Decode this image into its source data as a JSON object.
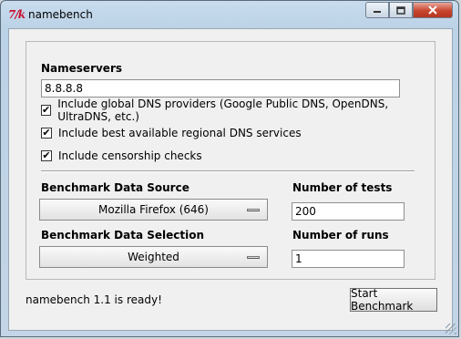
{
  "window": {
    "title": "namebench",
    "icon_label": "7/k",
    "icon": "tk-feather-icon",
    "controls": {
      "minimize": "minimize-icon",
      "maximize": "maximize-icon",
      "close": "close-icon"
    }
  },
  "nameservers": {
    "label": "Nameservers",
    "value": "8.8.8.8"
  },
  "options": [
    {
      "label": "Include global DNS providers (Google Public DNS, OpenDNS, UltraDNS, etc.)",
      "checked": true
    },
    {
      "label": "Include best available regional DNS services",
      "checked": true
    },
    {
      "label": "Include censorship checks",
      "checked": true
    }
  ],
  "benchmark_source": {
    "label": "Benchmark Data Source",
    "selected": "Mozilla Firefox (646)"
  },
  "benchmark_selection": {
    "label": "Benchmark Data Selection",
    "selected": "Weighted"
  },
  "num_tests": {
    "label": "Number of tests",
    "value": "200"
  },
  "num_runs": {
    "label": "Number of runs",
    "value": "1"
  },
  "status": {
    "text": "namebench 1.1 is ready!"
  },
  "start_button": {
    "label": "Start Benchmark"
  },
  "colors": {
    "close_button": "#c8452f",
    "icon": "#c8102e"
  }
}
